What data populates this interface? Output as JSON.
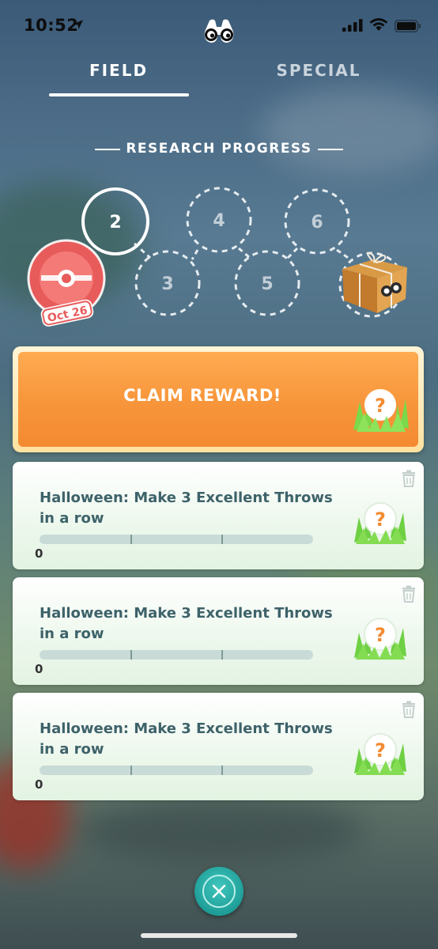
{
  "status_bar": {
    "time": "10:52"
  },
  "tabs": [
    {
      "label": "FIELD",
      "active": true
    },
    {
      "label": "SPECIAL",
      "active": false
    }
  ],
  "research_progress": {
    "title": "RESEARCH PROGRESS",
    "steps": [
      "2",
      "3",
      "4",
      "5",
      "6"
    ],
    "completed_step": "2",
    "stamp_date": "Oct 26"
  },
  "claim_button": {
    "label": "CLAIM REWARD!"
  },
  "tasks": [
    {
      "title": "Halloween: Make 3 Excellent Throws in a row",
      "count": "0",
      "progress": 0
    },
    {
      "title": "Halloween: Make 3 Excellent Throws in a row",
      "count": "0",
      "progress": 0
    },
    {
      "title": "Halloween: Make 3 Excellent Throws in a row",
      "count": "0",
      "progress": 0
    }
  ],
  "colors": {
    "claim_orange": "#f7953a",
    "close_teal": "#1f9e98",
    "task_text": "#3d6269",
    "stamp_red": "#e85b5b"
  },
  "icons": [
    "location-arrow-icon",
    "binoculars-icon",
    "signal-icon",
    "wifi-icon",
    "battery-icon",
    "trash-icon",
    "mystery-reward-icon",
    "close-icon",
    "gift-box-icon",
    "stamp-icon"
  ]
}
